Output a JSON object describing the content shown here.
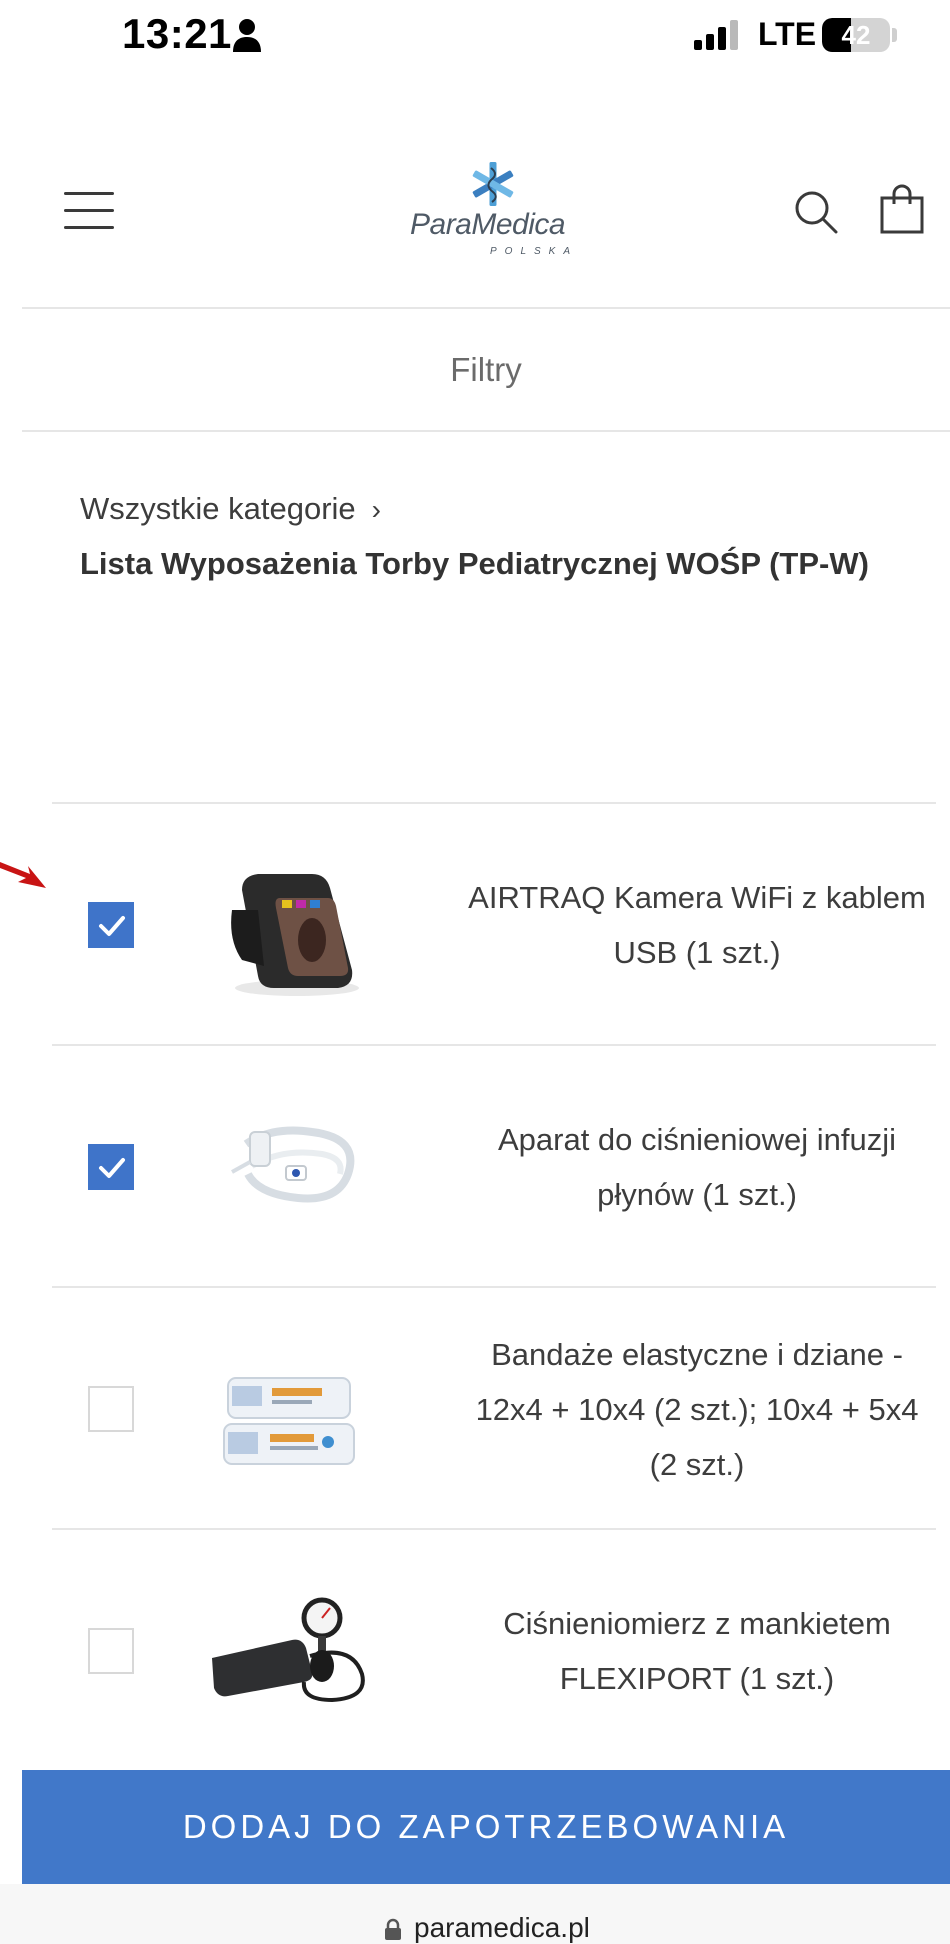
{
  "status_bar": {
    "time": "13:21",
    "network": "LTE",
    "battery_percent": "42",
    "battery_level": 0.42
  },
  "header": {
    "logo_name": "ParaMedica",
    "logo_sub": "POLSKA",
    "icons": [
      "menu-icon",
      "search-icon",
      "cart-icon"
    ]
  },
  "filters": {
    "label": "Filtry"
  },
  "breadcrumb": {
    "root": "Wszystkie kategorie",
    "separator": "›",
    "current": "Lista Wyposażenia Torby Pediatrycznej WOŚP (TP-W)"
  },
  "products": [
    {
      "name": "AIRTRAQ Kamera WiFi z kablem USB (1 szt.)",
      "checked": true,
      "image": "camera-device-image"
    },
    {
      "name": "Aparat do ciśnieniowej infuzji płynów (1 szt.)",
      "checked": true,
      "image": "infusion-set-image"
    },
    {
      "name": "Bandaże elastyczne i dziane - 12x4 + 10x4 (2 szt.); 10x4 + 5x4 (2 szt.)",
      "checked": false,
      "image": "bandage-image"
    },
    {
      "name": "Ciśnieniomierz z mankietem FLEXIPORT (1 szt.)",
      "checked": false,
      "image": "blood-pressure-cuff-image"
    }
  ],
  "cta": {
    "label": "DODAJ DO ZAPOTRZEBOWANIA"
  },
  "url_bar": {
    "url": "paramedica.pl"
  },
  "colors": {
    "accent": "#4178c9",
    "checkbox_checked": "#3f74c9",
    "annotation_arrow": "#c81414"
  }
}
